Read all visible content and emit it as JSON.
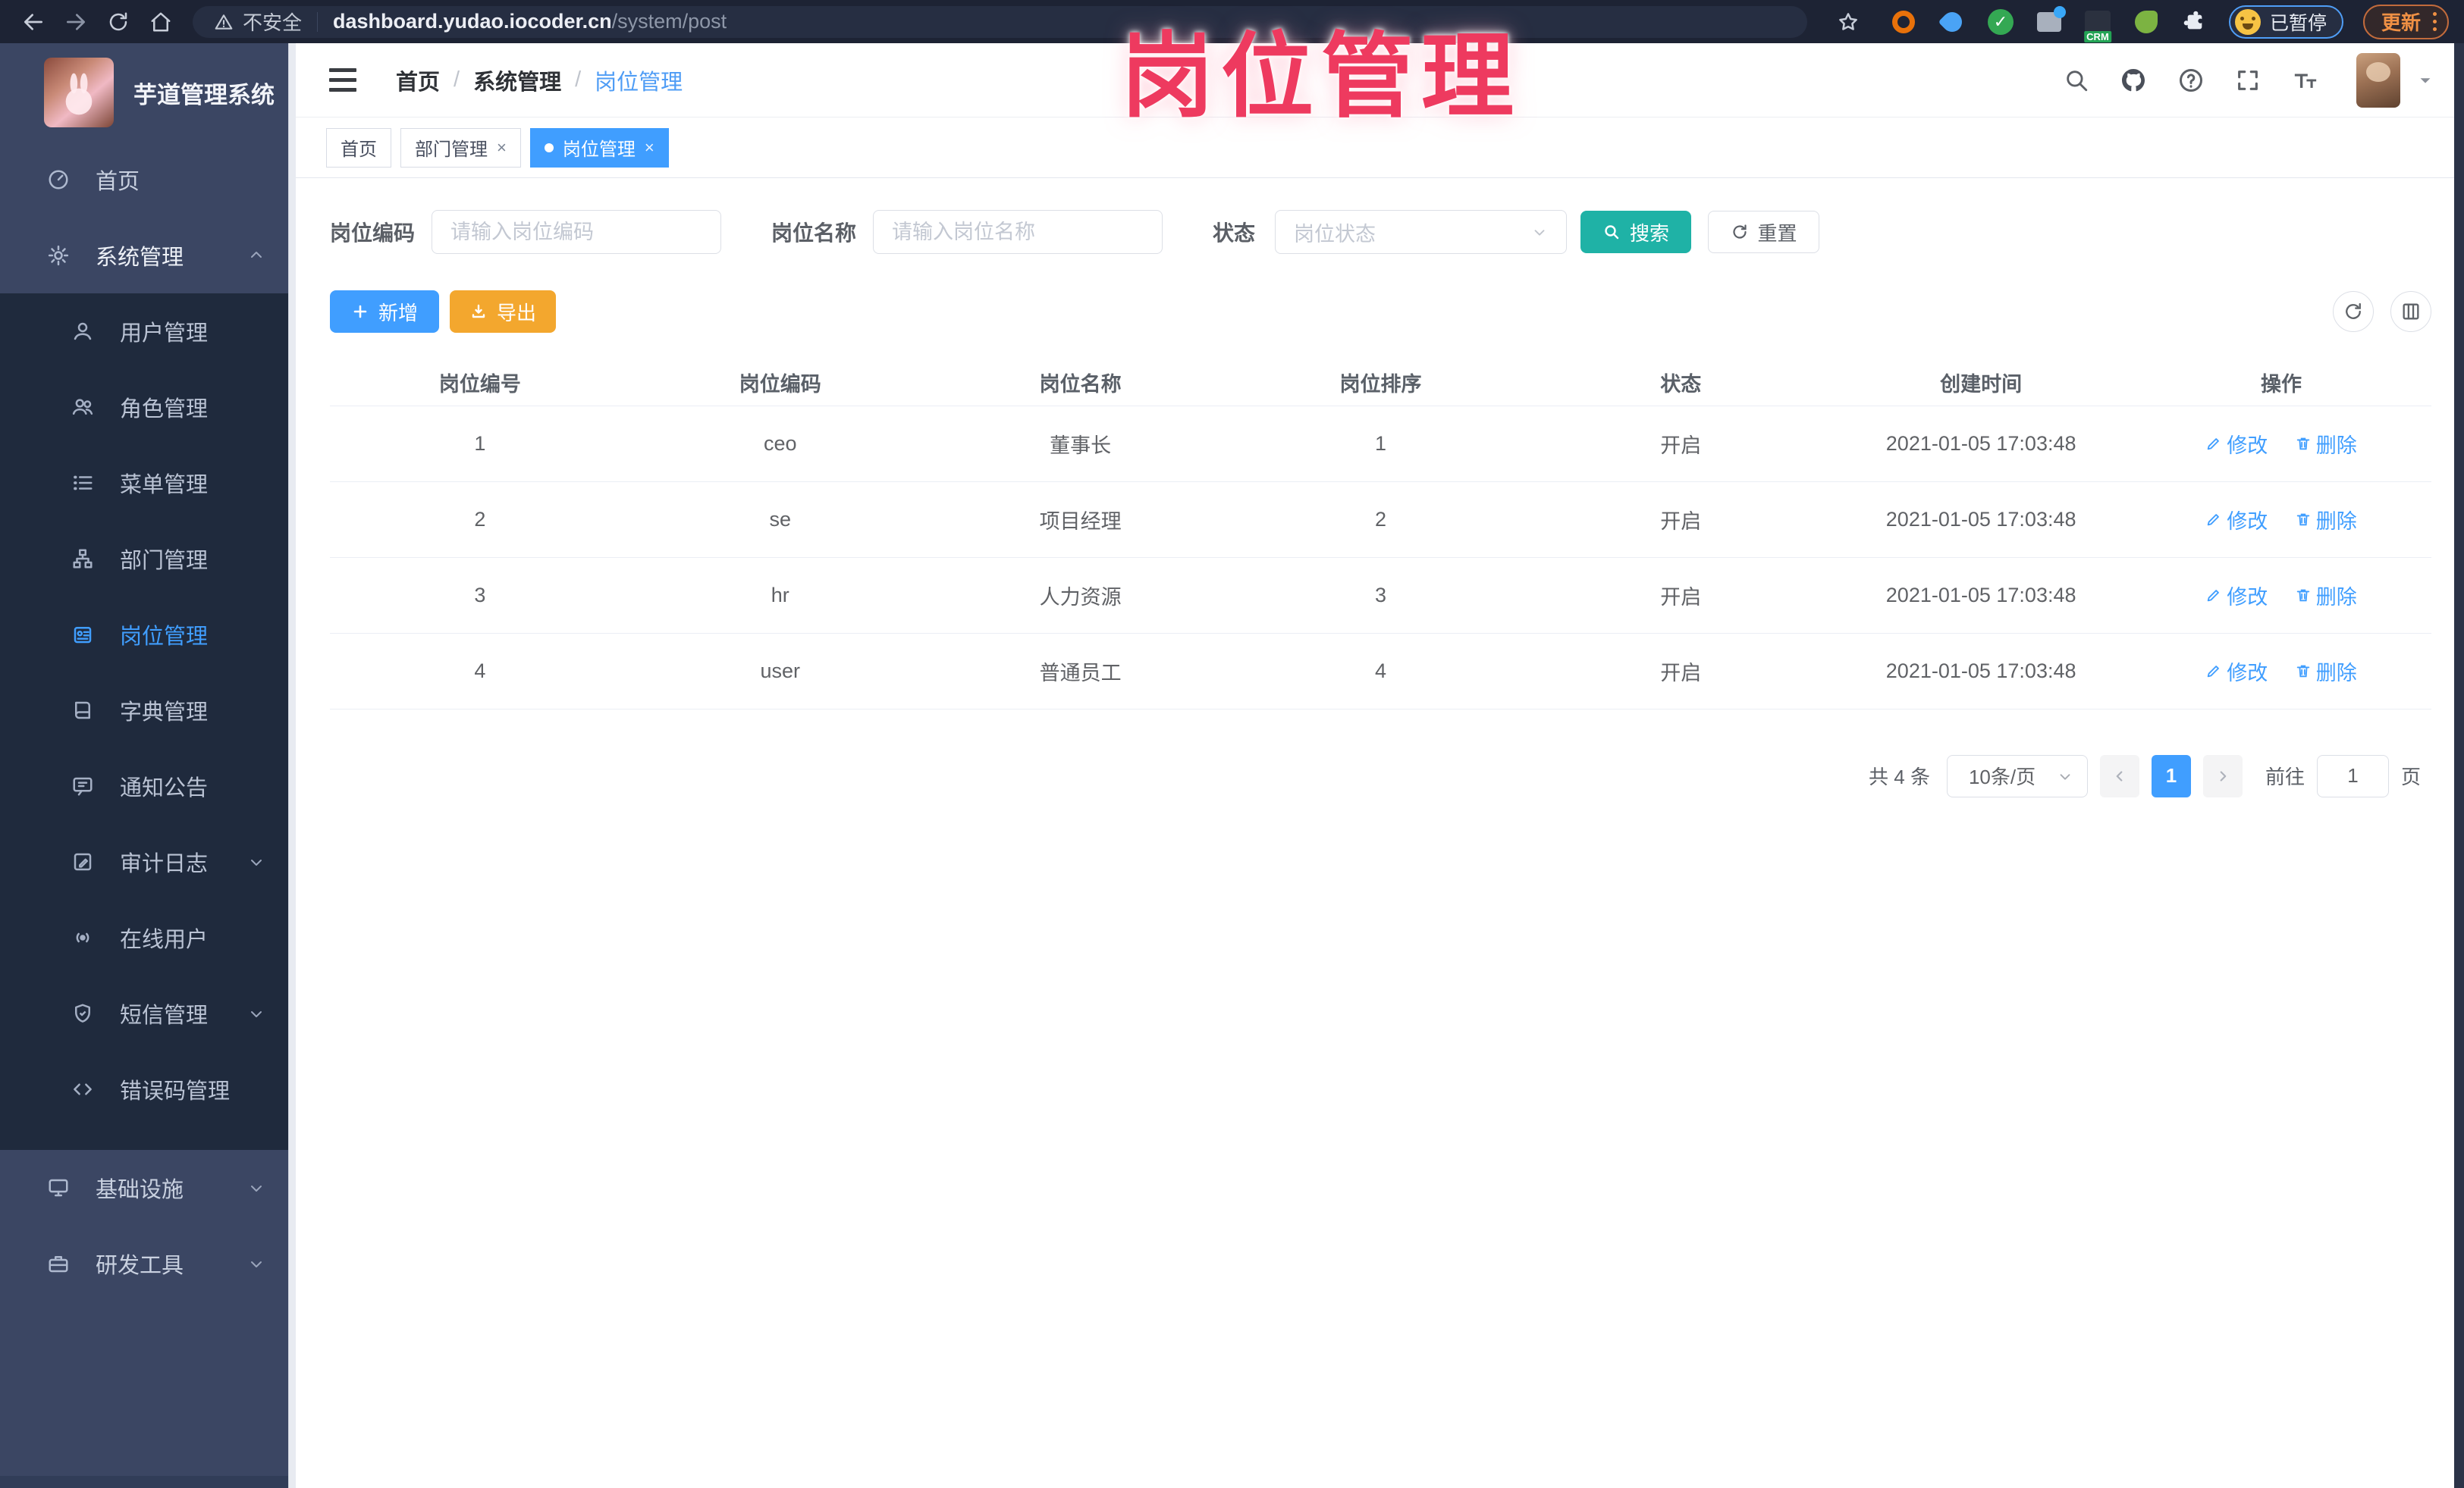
{
  "browser": {
    "security": "不安全",
    "host": "dashboard.yudao.iocoder.cn",
    "path": "/system/post",
    "crm_badge": "CRM",
    "paused_label": "已暂停",
    "update_label": "更新"
  },
  "overlay": {
    "title": "岗位管理"
  },
  "sidebar": {
    "app_title": "芋道管理系统",
    "items": [
      {
        "label": "首页"
      },
      {
        "label": "系统管理"
      },
      {
        "label": "用户管理"
      },
      {
        "label": "角色管理"
      },
      {
        "label": "菜单管理"
      },
      {
        "label": "部门管理"
      },
      {
        "label": "岗位管理"
      },
      {
        "label": "字典管理"
      },
      {
        "label": "通知公告"
      },
      {
        "label": "审计日志"
      },
      {
        "label": "在线用户"
      },
      {
        "label": "短信管理"
      },
      {
        "label": "错误码管理"
      },
      {
        "label": "基础设施"
      },
      {
        "label": "研发工具"
      }
    ]
  },
  "header": {
    "breadcrumb": [
      "首页",
      "系统管理",
      "岗位管理"
    ]
  },
  "tabs": [
    {
      "label": "首页"
    },
    {
      "label": "部门管理"
    },
    {
      "label": "岗位管理"
    }
  ],
  "filter": {
    "code_label": "岗位编码",
    "code_placeholder": "请输入岗位编码",
    "name_label": "岗位名称",
    "name_placeholder": "请输入岗位名称",
    "status_label": "状态",
    "status_placeholder": "岗位状态",
    "search_label": "搜索",
    "reset_label": "重置"
  },
  "toolbar": {
    "add_label": "新增",
    "export_label": "导出"
  },
  "table": {
    "headers": [
      "岗位编号",
      "岗位编码",
      "岗位名称",
      "岗位排序",
      "状态",
      "创建时间",
      "操作"
    ],
    "actions": {
      "edit": "修改",
      "delete": "删除"
    },
    "rows": [
      {
        "id": "1",
        "code": "ceo",
        "name": "董事长",
        "sort": "1",
        "status": "开启",
        "created": "2021-01-05 17:03:48"
      },
      {
        "id": "2",
        "code": "se",
        "name": "项目经理",
        "sort": "2",
        "status": "开启",
        "created": "2021-01-05 17:03:48"
      },
      {
        "id": "3",
        "code": "hr",
        "name": "人力资源",
        "sort": "3",
        "status": "开启",
        "created": "2021-01-05 17:03:48"
      },
      {
        "id": "4",
        "code": "user",
        "name": "普通员工",
        "sort": "4",
        "status": "开启",
        "created": "2021-01-05 17:03:48"
      }
    ]
  },
  "pagination": {
    "total": "共 4 条",
    "page_size": "10条/页",
    "current_page": "1",
    "goto_label": "前往",
    "goto_value": "1",
    "unit_label": "页"
  },
  "colors": {
    "accent": "#409eff",
    "search_teal": "#1fb2a6",
    "export_orange": "#f3a72e",
    "overlay_pink": "#ee3a5f"
  }
}
